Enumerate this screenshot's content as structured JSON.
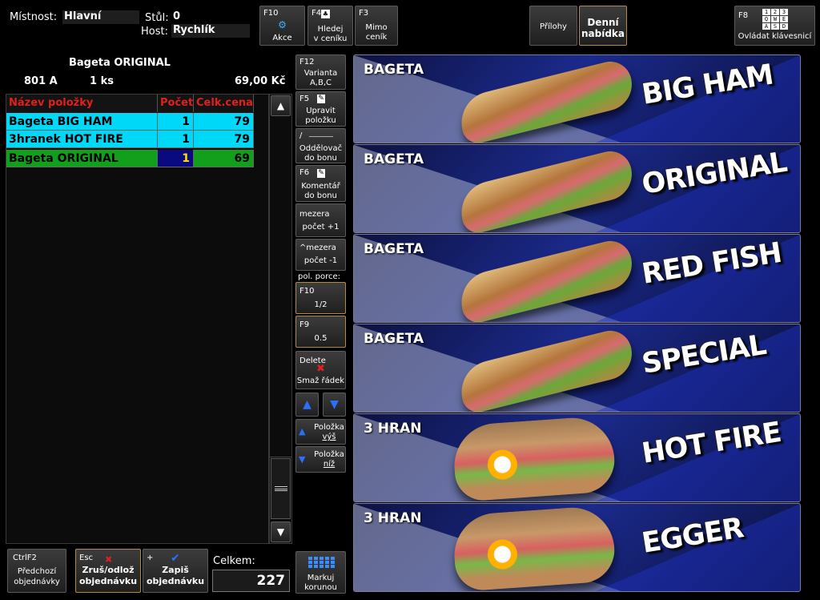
{
  "header": {
    "room_label": "Místnost:",
    "room_value": "Hlavní",
    "table_label": "Stůl:",
    "table_value": "0",
    "guest_label": "Host:",
    "guest_value": "Rychlík"
  },
  "toolbar": {
    "actions": {
      "key": "F10",
      "label": "Akce"
    },
    "search": {
      "key": "F4",
      "label1": "Hledej",
      "label2": "v ceníku"
    },
    "off_price": {
      "key": "F3",
      "label1": "Mimo",
      "label2": "ceník"
    },
    "attachments": {
      "label": "Přílohy"
    },
    "daily_menu": {
      "label1": "Denní",
      "label2": "nabídka"
    },
    "keyboard": {
      "key": "F8",
      "label": "Ovládat klávesnicí",
      "keys": [
        "1",
        "2",
        "3",
        "Q",
        "W",
        "E",
        "A",
        "S",
        "D"
      ]
    }
  },
  "selected_item": {
    "name": "Bageta ORIGINAL",
    "code": "801 A",
    "qty": "1 ks",
    "price": "69,00 Kč"
  },
  "order_table": {
    "columns": [
      "Název položky",
      "Počet",
      "Celk.cena"
    ],
    "rows": [
      {
        "name": "Bageta BIG HAM",
        "qty": "1",
        "price": "79"
      },
      {
        "name": "3hranek HOT FIRE",
        "qty": "1",
        "price": "79"
      },
      {
        "name": "Bageta ORIGINAL",
        "qty": "1",
        "price": "69"
      }
    ]
  },
  "side_buttons": {
    "variant": {
      "key": "F12",
      "label1": "Varianta",
      "label2": "A,B,C"
    },
    "edit": {
      "key": "F5",
      "label1": "Upravit",
      "label2": "položku"
    },
    "separator": {
      "key": "/",
      "label1": "Oddělovač",
      "label2": "do bonu"
    },
    "comment": {
      "key": "F6",
      "label1": "Komentář",
      "label2": "do bonu"
    },
    "count_plus": {
      "key": "mezera",
      "label": "počet +1"
    },
    "count_minus": {
      "key": "^mezera",
      "label": "počet -1"
    },
    "portion_label": "pol. porce:",
    "half": {
      "key": "F10",
      "label": "1/2"
    },
    "point_five": {
      "key": "F9",
      "label": "0.5"
    },
    "delete": {
      "key": "Delete",
      "label": "Smaž řádek"
    },
    "item_up": {
      "label1": "Položka",
      "label2": "výš"
    },
    "item_down": {
      "label1": "Položka",
      "label2": "níž"
    },
    "crown": {
      "label1": "Markuj",
      "label2": "korunou"
    }
  },
  "footer": {
    "previous": {
      "key": "CtrlF2",
      "label1": "Předchozí",
      "label2": "objednávky"
    },
    "cancel": {
      "key": "Esc",
      "label1": "Zruš/odlož",
      "label2": "objednávku"
    },
    "save": {
      "key": "+",
      "label1": "Zapiš",
      "label2": "objednávku"
    },
    "total_label": "Celkem:",
    "total_value": "227"
  },
  "products": [
    {
      "tag": "BAGETA",
      "name": "BIG HAM"
    },
    {
      "tag": "BAGETA",
      "name": "ORIGINAL"
    },
    {
      "tag": "BAGETA",
      "name": "RED FISH"
    },
    {
      "tag": "BAGETA",
      "name": "SPECIAL"
    },
    {
      "tag": "3 HRAN",
      "name": "HOT FIRE"
    },
    {
      "tag": "3 HRAN",
      "name": "EGGER"
    }
  ],
  "colors": {
    "header_red": "#e0201a",
    "row_cyan": "#00d8f8",
    "row_green": "#12a01c",
    "tile_blue": "#1b2a8c"
  }
}
